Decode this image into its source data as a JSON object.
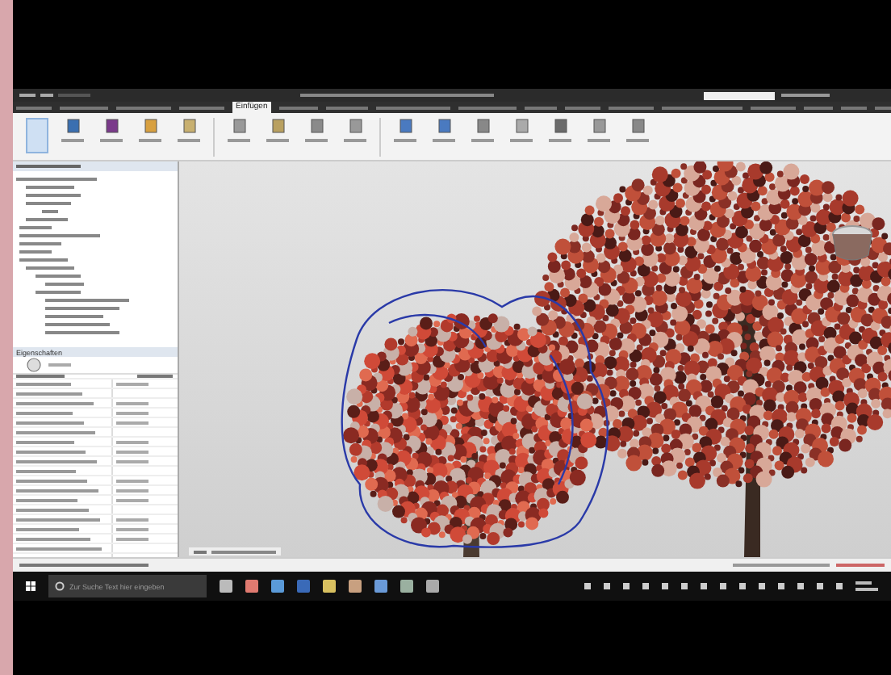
{
  "ribbon": {
    "tabs": [
      {
        "label": "Einfügen",
        "selected": true
      }
    ]
  },
  "properties": {
    "title": "Eigenschaften"
  },
  "taskbar": {
    "search": {
      "placeholder": "Zur Suche Text hier eingeben"
    }
  }
}
